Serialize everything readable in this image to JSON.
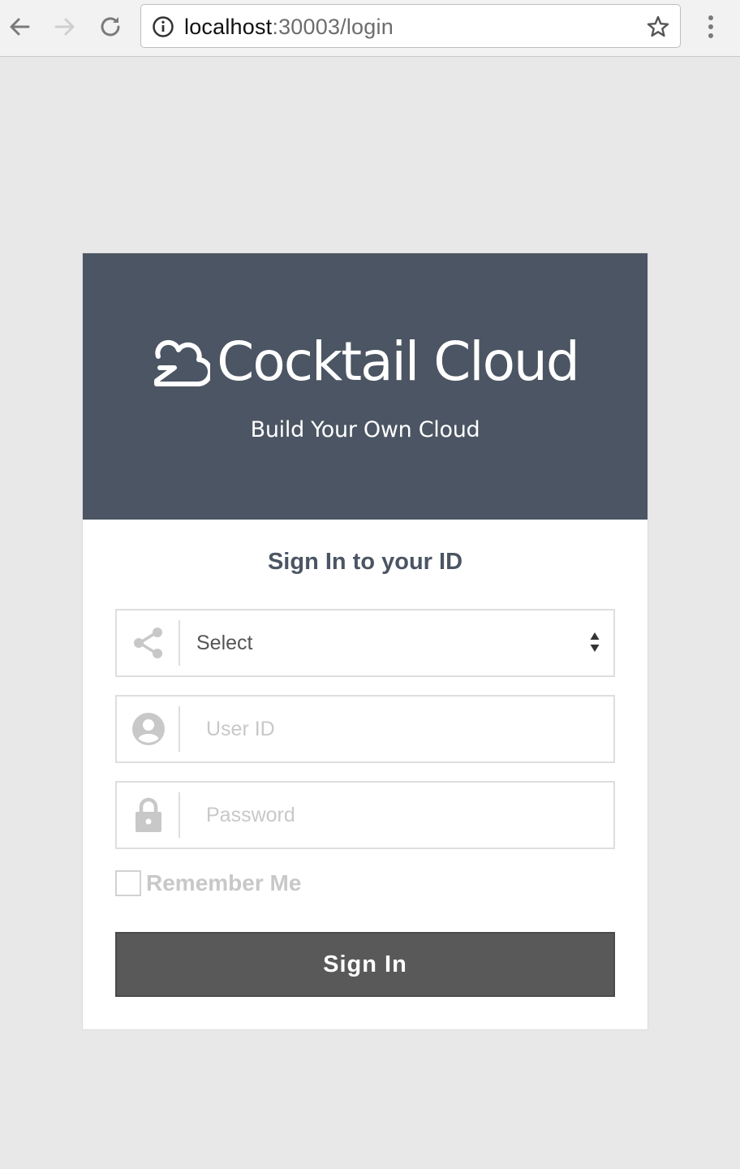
{
  "browser": {
    "url_host": "localhost",
    "url_path": ":30003/login",
    "icons": {
      "back": "arrow-left-icon",
      "forward": "arrow-right-icon",
      "reload": "reload-icon",
      "info": "info-icon",
      "bookmark": "star-icon",
      "menu": "more-vert-icon"
    }
  },
  "header": {
    "brand_name": "Cocktail Cloud",
    "tagline": "Build Your Own Cloud",
    "background_color": "#4b5563"
  },
  "form": {
    "title": "Sign In to your ID",
    "select": {
      "value": "Select",
      "icon": "share-icon"
    },
    "user_id": {
      "placeholder": "User ID",
      "value": "",
      "icon": "user-circle-icon"
    },
    "password": {
      "placeholder": "Password",
      "value": "",
      "icon": "lock-icon"
    },
    "remember_me": {
      "label": "Remember Me",
      "checked": false
    },
    "submit_label": "Sign In",
    "submit_color": "#595959"
  }
}
